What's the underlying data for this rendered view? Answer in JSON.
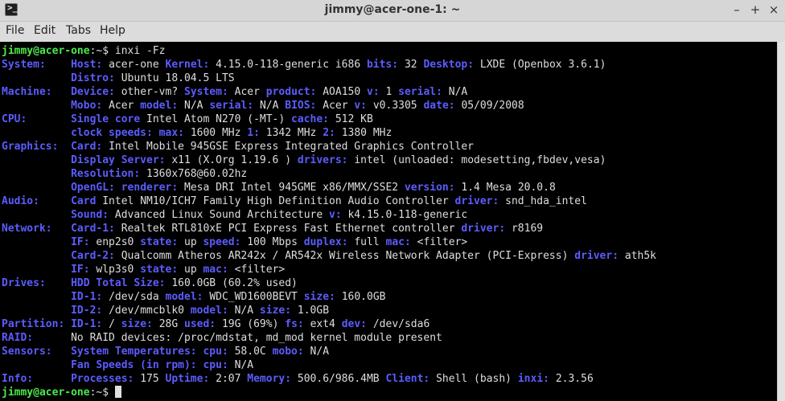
{
  "window": {
    "title": "jimmy@acer-one-1: ~",
    "app_icon_glyph": ">_",
    "controls": {
      "minimize": "–",
      "maximize": "+",
      "close": "×"
    }
  },
  "menu": [
    "File",
    "Edit",
    "Tabs",
    "Help"
  ],
  "colors": {
    "label": "#5c5cff",
    "prompt_user": "#4ce94c",
    "text": "#dedede",
    "background": "#000000"
  },
  "prompt": {
    "user_host": "jimmy@acer-one",
    "suffix": ":~$ "
  },
  "command": "inxi -Fz",
  "output": [
    [
      [
        "b",
        "System:    "
      ],
      [
        "b",
        "Host: "
      ],
      [
        "t",
        "acer-one "
      ],
      [
        "b",
        "Kernel: "
      ],
      [
        "t",
        "4.15.0-118-generic i686 "
      ],
      [
        "b",
        "bits: "
      ],
      [
        "t",
        "32 "
      ],
      [
        "b",
        "Desktop: "
      ],
      [
        "t",
        "LXDE (Openbox 3.6.1)"
      ]
    ],
    [
      [
        "t",
        "           "
      ],
      [
        "b",
        "Distro: "
      ],
      [
        "t",
        "Ubuntu 18.04.5 LTS"
      ]
    ],
    [
      [
        "b",
        "Machine:   "
      ],
      [
        "b",
        "Device: "
      ],
      [
        "t",
        "other-vm? "
      ],
      [
        "b",
        "System: "
      ],
      [
        "t",
        "Acer "
      ],
      [
        "b",
        "product: "
      ],
      [
        "t",
        "AOA150 "
      ],
      [
        "b",
        "v: "
      ],
      [
        "t",
        "1 "
      ],
      [
        "b",
        "serial: "
      ],
      [
        "t",
        "N/A"
      ]
    ],
    [
      [
        "t",
        "           "
      ],
      [
        "b",
        "Mobo: "
      ],
      [
        "t",
        "Acer "
      ],
      [
        "b",
        "model: "
      ],
      [
        "t",
        "N/A "
      ],
      [
        "b",
        "serial: "
      ],
      [
        "t",
        "N/A "
      ],
      [
        "b",
        "BIOS: "
      ],
      [
        "t",
        "Acer "
      ],
      [
        "b",
        "v: "
      ],
      [
        "t",
        "v0.3305 "
      ],
      [
        "b",
        "date: "
      ],
      [
        "t",
        "05/09/2008"
      ]
    ],
    [
      [
        "b",
        "CPU:       "
      ],
      [
        "b",
        "Single core "
      ],
      [
        "t",
        "Intel Atom N270 (-MT-) "
      ],
      [
        "b",
        "cache: "
      ],
      [
        "t",
        "512 KB"
      ]
    ],
    [
      [
        "t",
        "           "
      ],
      [
        "b",
        "clock speeds: "
      ],
      [
        "b",
        "max: "
      ],
      [
        "t",
        "1600 MHz "
      ],
      [
        "b",
        "1: "
      ],
      [
        "t",
        "1342 MHz "
      ],
      [
        "b",
        "2: "
      ],
      [
        "t",
        "1380 MHz"
      ]
    ],
    [
      [
        "b",
        "Graphics:  "
      ],
      [
        "b",
        "Card: "
      ],
      [
        "t",
        "Intel Mobile 945GSE Express Integrated Graphics Controller"
      ]
    ],
    [
      [
        "t",
        "           "
      ],
      [
        "b",
        "Display Server: "
      ],
      [
        "t",
        "x11 (X.Org 1.19.6 ) "
      ],
      [
        "b",
        "drivers: "
      ],
      [
        "t",
        "intel (unloaded: modesetting,fbdev,vesa)"
      ]
    ],
    [
      [
        "t",
        "           "
      ],
      [
        "b",
        "Resolution: "
      ],
      [
        "t",
        "1360x768@60.02hz"
      ]
    ],
    [
      [
        "t",
        "           "
      ],
      [
        "b",
        "OpenGL: "
      ],
      [
        "b",
        "renderer: "
      ],
      [
        "t",
        "Mesa DRI Intel 945GME x86/MMX/SSE2 "
      ],
      [
        "b",
        "version: "
      ],
      [
        "t",
        "1.4 Mesa 20.0.8"
      ]
    ],
    [
      [
        "b",
        "Audio:     "
      ],
      [
        "b",
        "Card "
      ],
      [
        "t",
        "Intel NM10/ICH7 Family High Definition Audio Controller "
      ],
      [
        "b",
        "driver: "
      ],
      [
        "t",
        "snd_hda_intel"
      ]
    ],
    [
      [
        "t",
        "           "
      ],
      [
        "b",
        "Sound: "
      ],
      [
        "t",
        "Advanced Linux Sound Architecture "
      ],
      [
        "b",
        "v: "
      ],
      [
        "t",
        "k4.15.0-118-generic"
      ]
    ],
    [
      [
        "b",
        "Network:   "
      ],
      [
        "b",
        "Card-1: "
      ],
      [
        "t",
        "Realtek RTL810xE PCI Express Fast Ethernet controller "
      ],
      [
        "b",
        "driver: "
      ],
      [
        "t",
        "r8169"
      ]
    ],
    [
      [
        "t",
        "           "
      ],
      [
        "b",
        "IF: "
      ],
      [
        "t",
        "enp2s0 "
      ],
      [
        "b",
        "state: "
      ],
      [
        "t",
        "up "
      ],
      [
        "b",
        "speed: "
      ],
      [
        "t",
        "100 Mbps "
      ],
      [
        "b",
        "duplex: "
      ],
      [
        "t",
        "full "
      ],
      [
        "b",
        "mac: "
      ],
      [
        "t",
        "<filter>"
      ]
    ],
    [
      [
        "t",
        "           "
      ],
      [
        "b",
        "Card-2: "
      ],
      [
        "t",
        "Qualcomm Atheros AR242x / AR542x Wireless Network Adapter (PCI-Express) "
      ],
      [
        "b",
        "driver: "
      ],
      [
        "t",
        "ath5k"
      ]
    ],
    [
      [
        "t",
        "           "
      ],
      [
        "b",
        "IF: "
      ],
      [
        "t",
        "wlp3s0 "
      ],
      [
        "b",
        "state: "
      ],
      [
        "t",
        "up "
      ],
      [
        "b",
        "mac: "
      ],
      [
        "t",
        "<filter>"
      ]
    ],
    [
      [
        "b",
        "Drives:    "
      ],
      [
        "b",
        "HDD Total Size: "
      ],
      [
        "t",
        "160.0GB (60.2% used)"
      ]
    ],
    [
      [
        "t",
        "           "
      ],
      [
        "b",
        "ID-1: "
      ],
      [
        "t",
        "/dev/sda "
      ],
      [
        "b",
        "model: "
      ],
      [
        "t",
        "WDC_WD1600BEVT "
      ],
      [
        "b",
        "size: "
      ],
      [
        "t",
        "160.0GB"
      ]
    ],
    [
      [
        "t",
        "           "
      ],
      [
        "b",
        "ID-2: "
      ],
      [
        "t",
        "/dev/mmcblk0 "
      ],
      [
        "b",
        "model: "
      ],
      [
        "t",
        "N/A "
      ],
      [
        "b",
        "size: "
      ],
      [
        "t",
        "1.0GB"
      ]
    ],
    [
      [
        "b",
        "Partition: "
      ],
      [
        "b",
        "ID-1: "
      ],
      [
        "t",
        "/ "
      ],
      [
        "b",
        "size: "
      ],
      [
        "t",
        "28G "
      ],
      [
        "b",
        "used: "
      ],
      [
        "t",
        "19G (69%) "
      ],
      [
        "b",
        "fs: "
      ],
      [
        "t",
        "ext4 "
      ],
      [
        "b",
        "dev: "
      ],
      [
        "t",
        "/dev/sda6"
      ]
    ],
    [
      [
        "b",
        "RAID:      "
      ],
      [
        "t",
        "No RAID devices: /proc/mdstat, md_mod kernel module present"
      ]
    ],
    [
      [
        "b",
        "Sensors:   "
      ],
      [
        "b",
        "System Temperatures: "
      ],
      [
        "b",
        "cpu: "
      ],
      [
        "t",
        "58.0C "
      ],
      [
        "b",
        "mobo: "
      ],
      [
        "t",
        "N/A"
      ]
    ],
    [
      [
        "t",
        "           "
      ],
      [
        "b",
        "Fan Speeds (in rpm): "
      ],
      [
        "b",
        "cpu: "
      ],
      [
        "t",
        "N/A"
      ]
    ],
    [
      [
        "b",
        "Info:      "
      ],
      [
        "b",
        "Processes: "
      ],
      [
        "t",
        "175 "
      ],
      [
        "b",
        "Uptime: "
      ],
      [
        "t",
        "2:07 "
      ],
      [
        "b",
        "Memory: "
      ],
      [
        "t",
        "500.6/986.4MB "
      ],
      [
        "b",
        "Client: "
      ],
      [
        "t",
        "Shell (bash) "
      ],
      [
        "b",
        "inxi: "
      ],
      [
        "t",
        "2.3.56"
      ]
    ]
  ]
}
